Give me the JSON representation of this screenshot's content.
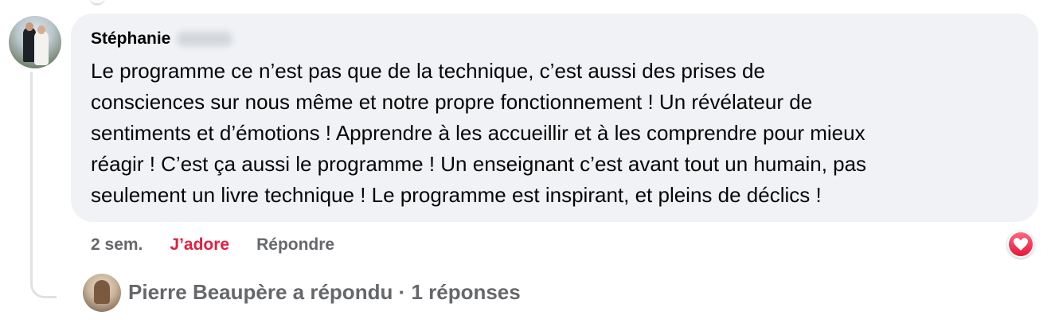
{
  "comment": {
    "author_name": "Stéphanie",
    "author_surname_blurred": true,
    "text": "Le programme ce n’est pas que de la technique, c’est aussi des prises de consciences sur nous même et notre propre fonctionnement ! Un révélateur de sentiments et d’émotions ! Apprendre à les accueillir et à les comprendre pour mieux réagir ! C’est ça aussi le programme ! Un enseignant c’est avant tout un humain, pas seulement un livre technique ! Le programme est inspirant, et pleins de déclics !",
    "lines": [
      "Le programme ce n’est pas que de la technique, c’est aussi des prises de",
      "consciences sur nous même et notre propre fonctionnement ! Un révélateur de",
      "sentiments et d’émotions ! Apprendre à les accueillir et à les comprendre pour mieux",
      "réagir ! C’est ça aussi le programme ! Un enseignant c’est avant tout un humain, pas",
      "seulement un livre technique ! Le programme est inspirant, et pleins de déclics !"
    ],
    "avatar_icon": "profile-photo-couple",
    "reaction_icon": "love-heart-icon"
  },
  "actions": {
    "timestamp": "2 sem.",
    "reaction_label": "J’adore",
    "reply_label": "Répondre"
  },
  "reply_summary": {
    "text": "Pierre Beaupère a répondu · 1 réponses",
    "avatar_icon": "profile-photo-pierre"
  },
  "colors": {
    "bubble_bg": "#f0f2f5",
    "text": "#050505",
    "secondary_text": "#65676b",
    "love_red": "#e41e3f",
    "thread_line": "#dfe1e5"
  }
}
